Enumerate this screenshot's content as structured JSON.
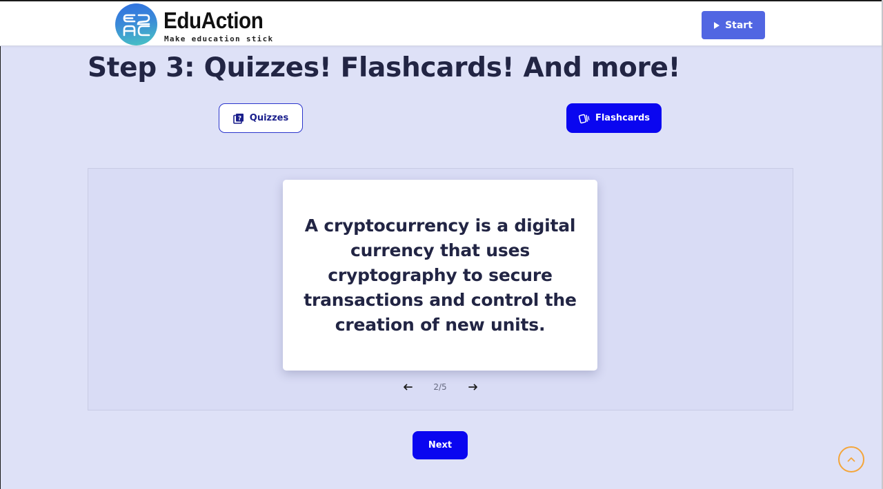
{
  "header": {
    "logo_name": "EduAction",
    "logo_tagline": "Make education stick",
    "logo_badge_letters": "E2AC",
    "start_label": "Start"
  },
  "main": {
    "title": "Step 3: Quizzes! Flashcards! And more!",
    "tabs": [
      {
        "label": "Quizzes",
        "icon": "quiz-book-icon",
        "active": false
      },
      {
        "label": "Flashcards",
        "icon": "flashcards-icon",
        "active": true
      }
    ],
    "flashcard": {
      "text": "A cryptocurrency is a digital currency that uses cryptography to secure transactions and control the creation of new units.",
      "counter": "2/5",
      "prev_icon": "arrow-left-icon",
      "next_icon": "arrow-right-icon"
    },
    "next_label": "Next"
  },
  "colors": {
    "background": "#dee1f7",
    "primary": "#0a06f0",
    "start_button": "#5166e2",
    "scroll_top_ring": "#f4a53a"
  }
}
